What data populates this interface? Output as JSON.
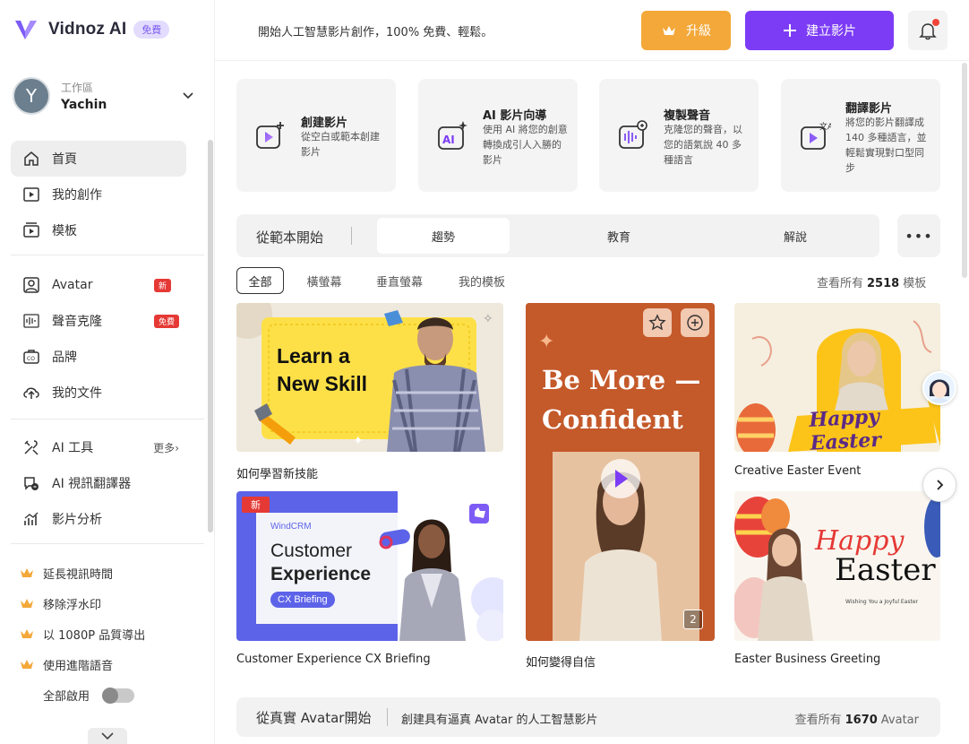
{
  "brand": {
    "name": "Vidnoz AI",
    "badge": "免費",
    "accent": "#7c3cf5"
  },
  "workspace": {
    "label": "工作區",
    "name": "Yachin",
    "initial": "Y"
  },
  "sidebar": {
    "primary": [
      {
        "label": "首頁",
        "icon": "home-icon",
        "active": true
      },
      {
        "label": "我的創作",
        "icon": "video-icon"
      },
      {
        "label": "模板",
        "icon": "template-icon"
      }
    ],
    "secondary": [
      {
        "label": "Avatar",
        "icon": "avatar-icon",
        "badge": "新"
      },
      {
        "label": "聲音克隆",
        "icon": "waveform-icon",
        "badge": "免費"
      },
      {
        "label": "品牌",
        "icon": "brand-icon"
      },
      {
        "label": "我的文件",
        "icon": "upload-cloud-icon"
      }
    ],
    "tools": [
      {
        "label": "AI 工具",
        "icon": "tools-icon",
        "more": "更多"
      },
      {
        "label": "AI 視訊翻譯器",
        "icon": "translate-icon"
      },
      {
        "label": "影片分析",
        "icon": "analytics-icon"
      }
    ],
    "perks": [
      "延長視訊時間",
      "移除浮水印",
      "以 1080P 品質導出",
      "使用進階語音"
    ],
    "enable_all": "全部啟用"
  },
  "topbar": {
    "tagline": "開始人工智慧影片創作，100% 免費、輕鬆。",
    "upgrade": "升級",
    "create": "建立影片"
  },
  "quick_cards": [
    {
      "title": "創建影片",
      "desc": "從空白或範本創建影片",
      "icon": "video-plus-icon"
    },
    {
      "title": "AI 影片向導",
      "desc": "使用 AI 將您的創意轉換成引人入勝的影片",
      "icon": "ai-sparkle-icon"
    },
    {
      "title": "複製聲音",
      "desc": "克隆您的聲音，以您的語氣說 40 多種語言",
      "icon": "voice-clone-icon"
    },
    {
      "title": "翻譯影片",
      "desc": "將您的影片翻譯成 140 多種語言，並輕鬆實現對口型同步",
      "icon": "video-translate-icon"
    }
  ],
  "templates": {
    "title": "從範本開始",
    "tabs": [
      "趨勢",
      "教育",
      "解說"
    ],
    "filters": [
      "全部",
      "橫螢幕",
      "垂直螢幕",
      "我的模板"
    ],
    "view_all_prefix": "查看所有",
    "count": "2518",
    "view_all_suffix": "模板",
    "cards": [
      {
        "caption": "如何學習新技能",
        "art_text": [
          "Learn a",
          "New Skill"
        ]
      },
      {
        "caption": "如何變得自信",
        "art_text": [
          "Be More —",
          "Confident"
        ],
        "page_badge": "2"
      },
      {
        "caption": "Creative Easter Event",
        "art_text": [
          "Happy Easter"
        ]
      },
      {
        "caption": "Customer Experience CX Briefing",
        "badge": "新",
        "art_text": [
          "WindCRM",
          "Customer",
          "Experience",
          "CX Briefing"
        ]
      },
      {
        "caption": "Easter Business Greeting",
        "art_text": [
          "Happy",
          "Easter",
          "Wishing You a Joyful Easter"
        ]
      }
    ]
  },
  "avatar_section": {
    "title": "從真實 Avatar開始",
    "desc": "創建具有逼真 Avatar 的人工智慧影片",
    "view_all_prefix": "查看所有",
    "count": "1670",
    "view_all_suffix": "Avatar"
  }
}
